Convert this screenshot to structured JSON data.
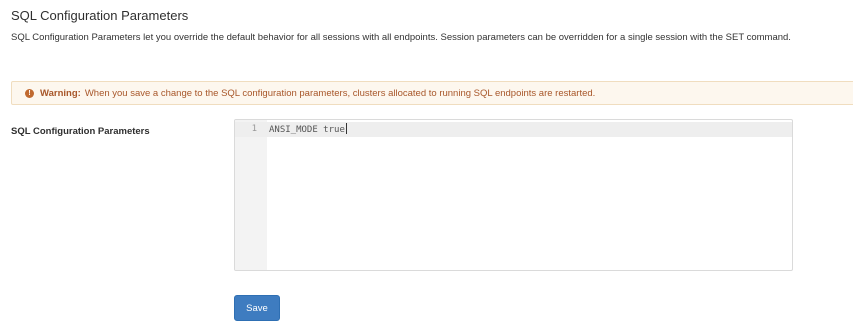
{
  "section": {
    "title": "SQL Configuration Parameters",
    "description": "SQL Configuration Parameters let you override the default behavior for all sessions with all endpoints. Session parameters can be overridden for a single session with the SET command."
  },
  "warning": {
    "icon": "exclamation-icon",
    "prefix": "Warning:",
    "message": "When you save a change to the SQL configuration parameters, clusters allocated to running SQL endpoints are restarted.",
    "color": "#a8572a",
    "background": "#fdf7ee"
  },
  "form": {
    "field_label": "SQL Configuration Parameters",
    "editor": {
      "lines": [
        {
          "number": "1",
          "text": "ANSI_MODE true"
        }
      ]
    },
    "save_label": "Save",
    "save_color": "#3e7cc0"
  }
}
